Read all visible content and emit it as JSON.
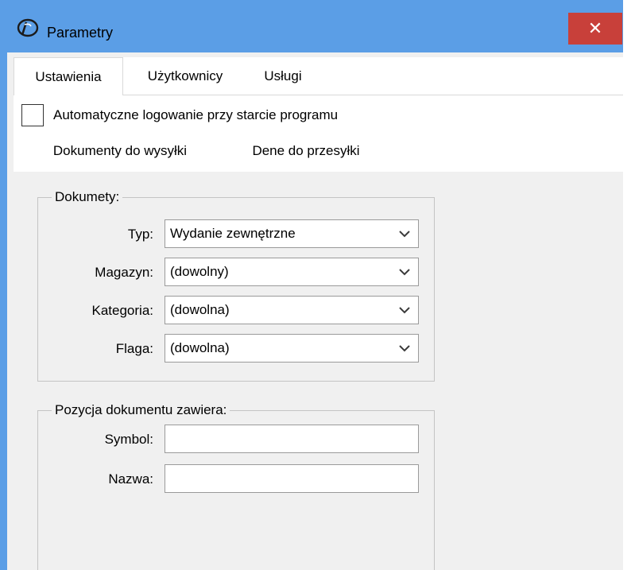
{
  "window": {
    "title": "Parametry",
    "close_glyph": "✕",
    "app_icon": "app-logo-icon",
    "colors": {
      "titlebar": "#5b9ee6",
      "close_button": "#c8403a",
      "content_bg": "#ffffff",
      "panel_bg": "#f0f0f0"
    }
  },
  "main_tabs": [
    {
      "label": "Ustawienia",
      "active": true
    },
    {
      "label": "Użytkownicy",
      "active": false
    },
    {
      "label": "Usługi",
      "active": false
    }
  ],
  "settings": {
    "auto_login_label": "Automatyczne logowanie przy starcie programu",
    "auto_login_checked": false
  },
  "sub_tabs": [
    {
      "label": "Dokumenty do wysyłki",
      "active": true
    },
    {
      "label": "Dene do przesyłki",
      "active": false
    }
  ],
  "documents_group": {
    "legend": "Dokumety:",
    "fields": [
      {
        "label": "Typ:",
        "value": "Wydanie zewnętrzne"
      },
      {
        "label": "Magazyn:",
        "value": "(dowolny)"
      },
      {
        "label": "Kategoria:",
        "value": "(dowolna)"
      },
      {
        "label": "Flaga:",
        "value": "(dowolna)"
      }
    ]
  },
  "position_group": {
    "legend": "Pozycja dokumentu zawiera:",
    "fields": [
      {
        "label": "Symbol:",
        "value": ""
      },
      {
        "label": "Nazwa:",
        "value": ""
      }
    ]
  }
}
